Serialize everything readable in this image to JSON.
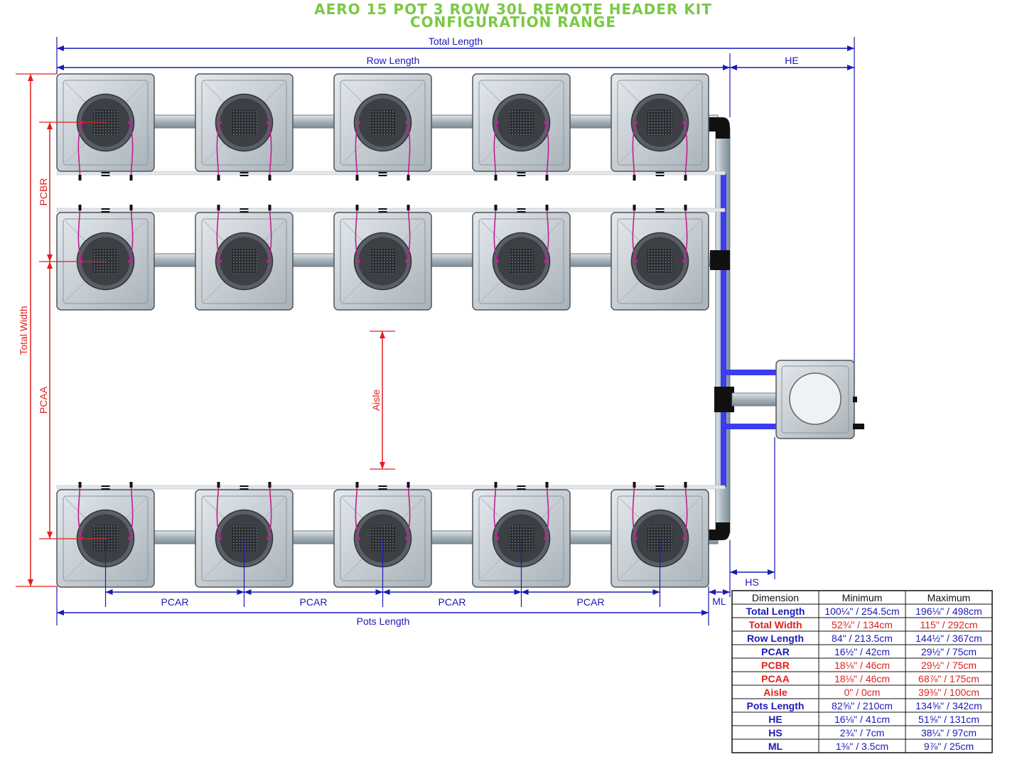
{
  "title_line1": "AERO 15 POT 3 ROW 30L REMOTE HEADER KIT",
  "title_line2": "CONFIGURATION RANGE",
  "labels": {
    "total_length": "Total Length",
    "row_length": "Row Length",
    "he": "HE",
    "total_width": "Total Width",
    "pcbr": "PCBR",
    "pcaa": "PCAA",
    "aisle": "Aisle",
    "hs": "HS",
    "ml": "ML",
    "pcar": "PCAR",
    "pots_length": "Pots Length"
  },
  "table": {
    "headers": [
      "Dimension",
      "Minimum",
      "Maximum"
    ],
    "rows": [
      {
        "name": "Total Length",
        "min": "100¼\" / 254.5cm",
        "max": "196⅛\" / 498cm",
        "color": "blue"
      },
      {
        "name": "Total Width",
        "min": "52¾\" / 134cm",
        "max": "115\" / 292cm",
        "color": "red"
      },
      {
        "name": "Row Length",
        "min": "84\" / 213.5cm",
        "max": "144½\" / 367cm",
        "color": "blue"
      },
      {
        "name": "PCAR",
        "min": "16½\" / 42cm",
        "max": "29½\" / 75cm",
        "color": "blue"
      },
      {
        "name": "PCBR",
        "min": "18⅛\" / 46cm",
        "max": "29½\" / 75cm",
        "color": "red"
      },
      {
        "name": "PCAA",
        "min": "18⅛\" / 46cm",
        "max": "68⅞\" / 175cm",
        "color": "red"
      },
      {
        "name": "Aisle",
        "min": "0\" / 0cm",
        "max": "39⅜\" / 100cm",
        "color": "red"
      },
      {
        "name": "Pots Length",
        "min": "82⅝\" / 210cm",
        "max": "134⅝\" / 342cm",
        "color": "blue"
      },
      {
        "name": "HE",
        "min": "16⅛\" / 41cm",
        "max": "51⅝\" / 131cm",
        "color": "blue"
      },
      {
        "name": "HS",
        "min": "2¾\" / 7cm",
        "max": "38¼\" / 97cm",
        "color": "blue"
      },
      {
        "name": "ML",
        "min": "1⅜\" / 3.5cm",
        "max": "9⅞\" / 25cm",
        "color": "blue"
      }
    ]
  },
  "colors": {
    "title": "#7ac943",
    "blue_dimension": "#1a1ab8",
    "red_dimension": "#e0201c",
    "feed_line": "#3b3bf0",
    "drip_tube": "#c0208f",
    "pot_body": "#c9d0d6",
    "pot_lid": "#4a4e54",
    "pipe": "#a9b6be"
  },
  "layout": {
    "pot_rows": 3,
    "pots_per_row": 5
  }
}
